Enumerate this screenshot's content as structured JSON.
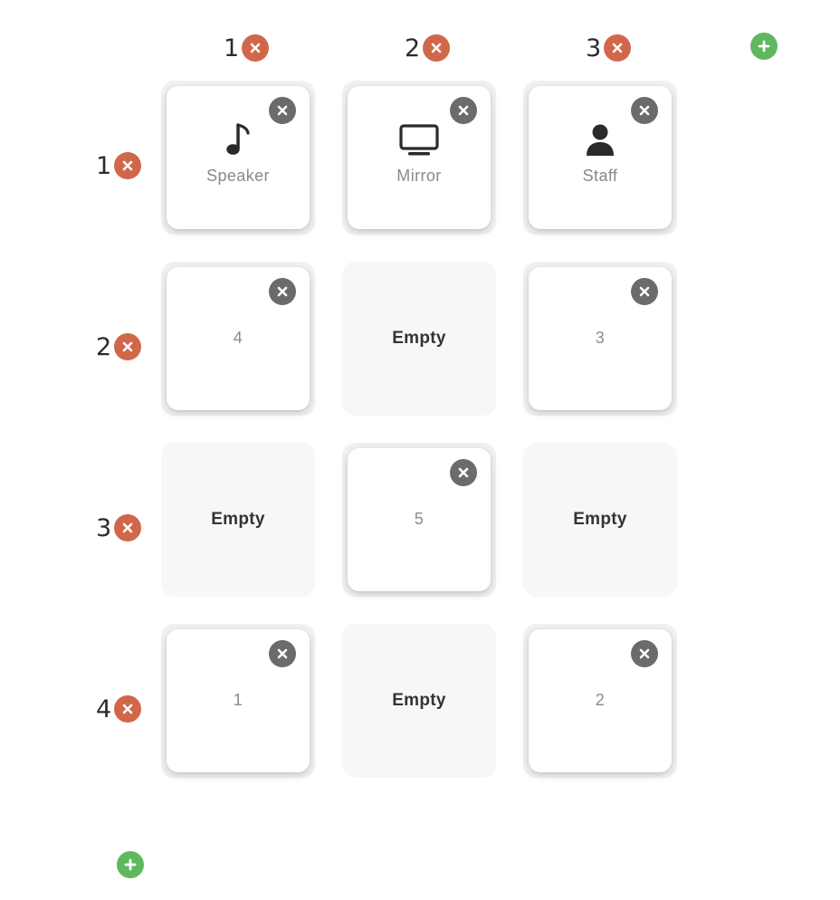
{
  "columns": [
    {
      "label": "1"
    },
    {
      "label": "2"
    },
    {
      "label": "3"
    }
  ],
  "rows": [
    {
      "label": "1"
    },
    {
      "label": "2"
    },
    {
      "label": "3"
    },
    {
      "label": "4"
    }
  ],
  "grid": [
    [
      {
        "type": "item",
        "label": "Speaker",
        "icon": "music-note-icon"
      },
      {
        "type": "item",
        "label": "Mirror",
        "icon": "monitor-icon"
      },
      {
        "type": "item",
        "label": "Staff",
        "icon": "person-icon"
      }
    ],
    [
      {
        "type": "item",
        "label": "4"
      },
      {
        "type": "empty",
        "label": "Empty"
      },
      {
        "type": "item",
        "label": "3"
      }
    ],
    [
      {
        "type": "empty",
        "label": "Empty"
      },
      {
        "type": "item",
        "label": "5"
      },
      {
        "type": "empty",
        "label": "Empty"
      }
    ],
    [
      {
        "type": "item",
        "label": "1"
      },
      {
        "type": "empty",
        "label": "Empty"
      },
      {
        "type": "item",
        "label": "2"
      }
    ]
  ],
  "colors": {
    "remove_header": "#d1674a",
    "remove_item": "#6b6b6b",
    "add": "#5fb85f"
  }
}
